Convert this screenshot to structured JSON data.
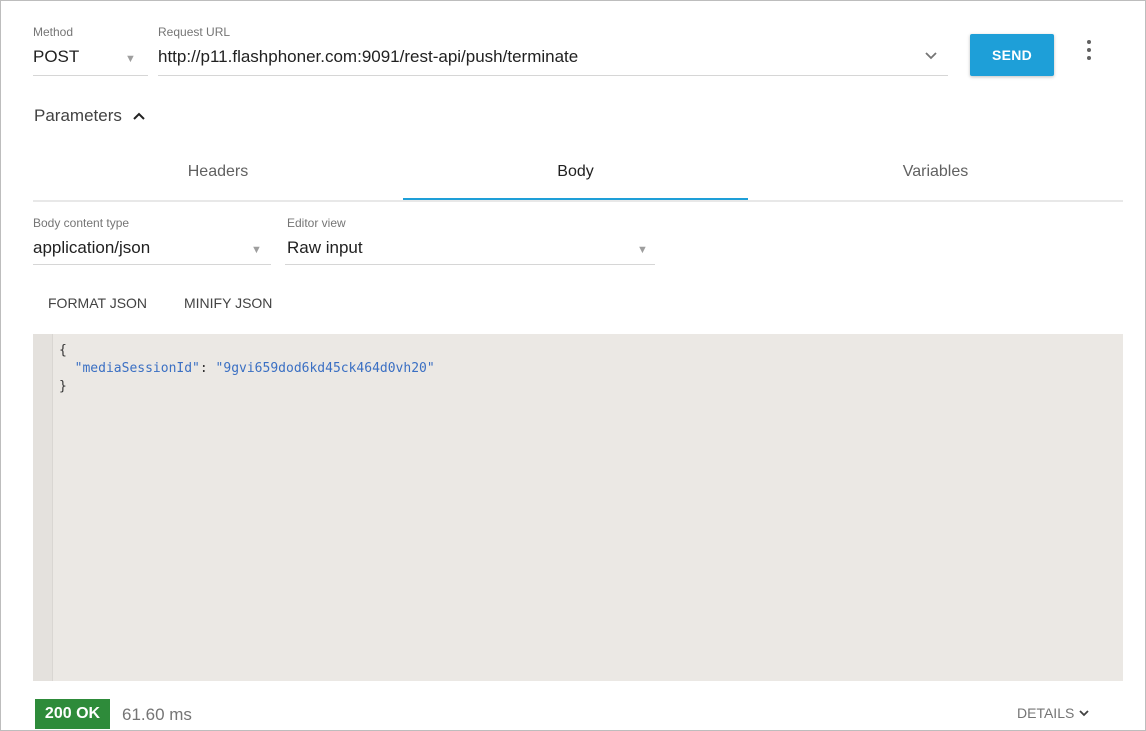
{
  "request": {
    "method_label": "Method",
    "method_value": "POST",
    "url_label": "Request URL",
    "url_value": "http://p11.flashphoner.com:9091/rest-api/push/terminate",
    "send_label": "SEND"
  },
  "parameters": {
    "label": "Parameters"
  },
  "tabs": [
    {
      "label": "Headers"
    },
    {
      "label": "Body"
    },
    {
      "label": "Variables"
    }
  ],
  "body": {
    "content_type_label": "Body content type",
    "content_type_value": "application/json",
    "editor_view_label": "Editor view",
    "editor_view_value": "Raw input",
    "format_label": "FORMAT JSON",
    "minify_label": "MINIFY JSON",
    "code": {
      "open": "{",
      "key": "\"mediaSessionId\"",
      "sep": ": ",
      "value": "\"9gvi659dod6kd45ck464d0vh20\"",
      "close": "}"
    }
  },
  "status": {
    "badge": "200 OK",
    "time": "61.60 ms",
    "details": "DETAILS",
    "badge_color": "#2e8b3a"
  },
  "colors": {
    "accent": "#1e9fd8",
    "editor_bg": "#ebe8e4"
  }
}
